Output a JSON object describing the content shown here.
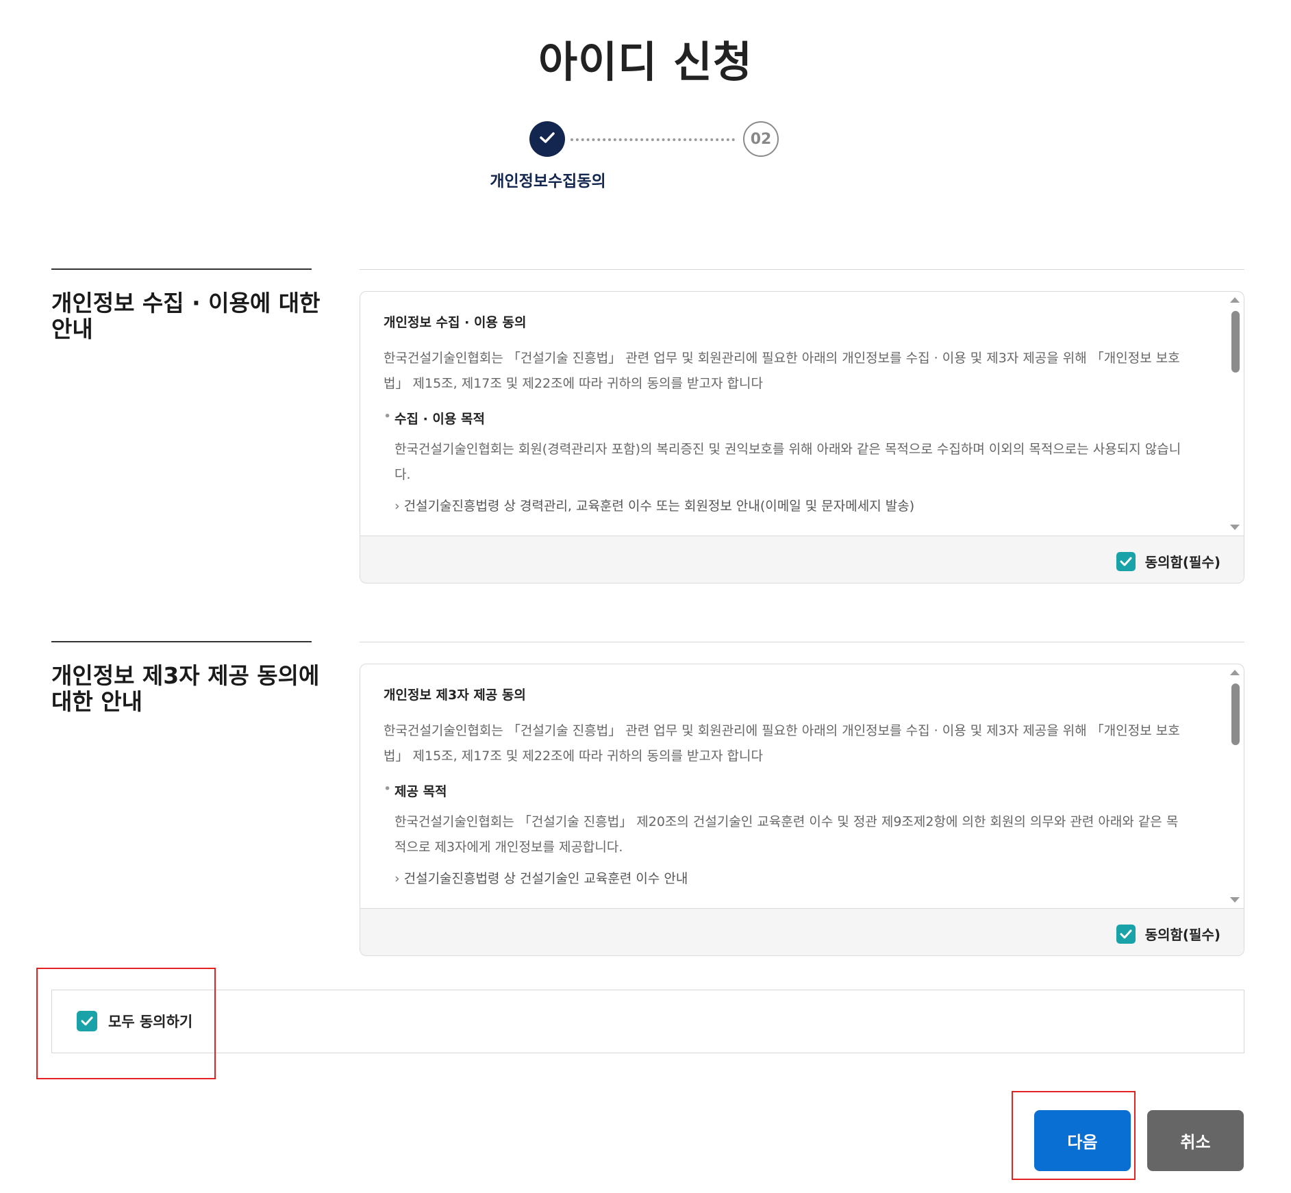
{
  "page": {
    "title": "아이디 신청"
  },
  "stepper": {
    "step1_label": "개인정보수집동의",
    "step2_number": "02"
  },
  "sections": [
    {
      "heading": "개인정보 수집 · 이용에 대한 안내",
      "terms": {
        "title": "개인정보 수집 · 이용 동의",
        "intro": "한국건설기술인협회는 「건설기술 진흥법」 관련 업무 및 회원관리에 필요한 아래의 개인정보를 수집 · 이용 및 제3자 제공을 위해 「개인정보 보호법」 제15조, 제17조 및 제22조에 따라 귀하의 동의를 받고자 합니다",
        "bullet": "수집 · 이용 목적",
        "desc": "한국건설기술인협회는 회원(경력관리자 포함)의 복리증진 및 권익보호를 위해 아래와 같은 목적으로 수집하며 이외의 목적으로는 사용되지 않습니다.",
        "sub": "건설기술진흥법령 상 경력관리, 교육훈련 이수 또는 회원정보 안내(이메일 및 문자메세지 발송)"
      },
      "agree_label": "동의함(필수)",
      "agree_checked": true
    },
    {
      "heading": "개인정보 제3자 제공 동의에 대한 안내",
      "terms": {
        "title": "개인정보 제3자 제공 동의",
        "intro": "한국건설기술인협회는 「건설기술 진흥법」 관련 업무 및 회원관리에 필요한 아래의 개인정보를 수집 · 이용 및 제3자 제공을 위해 「개인정보 보호법」 제15조, 제17조 및 제22조에 따라 귀하의 동의를 받고자 합니다",
        "bullet": "제공 목적",
        "desc": "한국건설기술인협회는 「건설기술 진흥법」 제20조의 건설기술인 교육훈련 이수 및 정관 제9조제2항에 의한 회원의 의무와 관련 아래와 같은 목적으로 제3자에게 개인정보를 제공합니다.",
        "sub": "건설기술진흥법령 상 건설기술인 교육훈련 이수 안내"
      },
      "agree_label": "동의함(필수)",
      "agree_checked": true
    }
  ],
  "agree_all": {
    "label": "모두 동의하기",
    "checked": true
  },
  "buttons": {
    "next": "다음",
    "cancel": "취소"
  },
  "colors": {
    "primary_navy": "#13264f",
    "checkbox_teal": "#19a3a8",
    "next_blue": "#0a6fd3",
    "cancel_gray": "#666666",
    "highlight_red": "#e52222"
  }
}
